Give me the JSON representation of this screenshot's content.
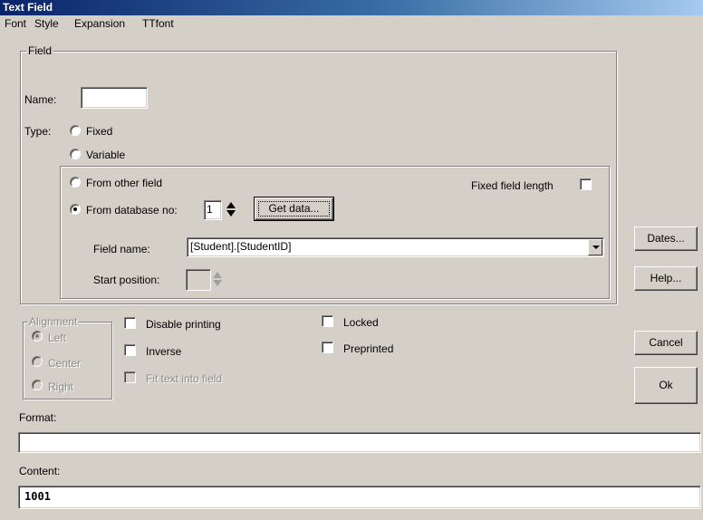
{
  "window": {
    "title": "Text Field"
  },
  "menu": [
    {
      "label": "Font"
    },
    {
      "label": "Style"
    },
    {
      "label": "Expansion"
    },
    {
      "label": "TTfont"
    }
  ],
  "field_group": {
    "legend": "Field",
    "name_label": "Name:",
    "name_value": "",
    "type_label": "Type:",
    "type_options": [
      {
        "label": "Fixed",
        "selected": false
      },
      {
        "label": "Variable",
        "selected": false
      }
    ],
    "source": {
      "from_other_field": {
        "label": "From other field",
        "selected": false
      },
      "from_database": {
        "label": "From database no:",
        "selected": true,
        "number": "1"
      },
      "get_data_button": "Get data...",
      "fixed_field_length": {
        "label": "Fixed field length",
        "checked": false
      },
      "field_name_label": "Field name:",
      "field_name_value": "[Student].[StudentID]",
      "start_position_label": "Start position:",
      "start_position_value": ""
    }
  },
  "alignment": {
    "legend": "Alignment",
    "options": [
      {
        "label": "Left",
        "selected": true
      },
      {
        "label": "Center",
        "selected": false
      },
      {
        "label": "Right",
        "selected": false
      }
    ]
  },
  "options": {
    "disable_printing": {
      "label": "Disable printing",
      "checked": false
    },
    "inverse": {
      "label": "Inverse",
      "checked": false
    },
    "fit_text": {
      "label": "Fit text into field",
      "checked": false
    },
    "locked": {
      "label": "Locked",
      "checked": false
    },
    "preprinted": {
      "label": "Preprinted",
      "checked": false
    }
  },
  "format": {
    "label": "Format:",
    "value": ""
  },
  "content": {
    "label": "Content:",
    "value": "1001"
  },
  "buttons": {
    "dates": "Dates...",
    "help": "Help...",
    "cancel": "Cancel",
    "ok": "Ok"
  }
}
